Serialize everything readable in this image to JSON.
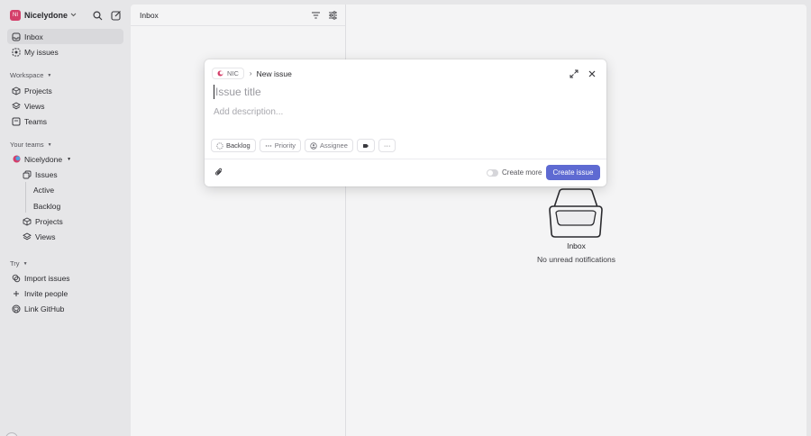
{
  "workspace": {
    "badge": "NI",
    "name": "Nicelydone",
    "accent": "#d43f6a"
  },
  "sidebar": {
    "top_items": [
      {
        "label": "Inbox",
        "icon": "inbox-icon",
        "active": true
      },
      {
        "label": "My issues",
        "icon": "target-icon",
        "active": false
      }
    ],
    "workspace_label": "Workspace",
    "workspace_items": [
      {
        "label": "Projects",
        "icon": "cube-icon"
      },
      {
        "label": "Views",
        "icon": "layers-icon"
      },
      {
        "label": "Teams",
        "icon": "square-icon"
      }
    ],
    "teams_label": "Your teams",
    "team": {
      "name": "Nicelydone"
    },
    "team_items": [
      {
        "label": "Issues",
        "icon": "stack-icon"
      },
      {
        "label": "Active"
      },
      {
        "label": "Backlog"
      },
      {
        "label": "Projects",
        "icon": "cube-icon"
      },
      {
        "label": "Views",
        "icon": "layers-icon"
      }
    ],
    "try_label": "Try",
    "try_items": [
      {
        "label": "Import issues",
        "icon": "import-icon"
      },
      {
        "label": "Invite people",
        "icon": "plus-icon"
      },
      {
        "label": "Link GitHub",
        "icon": "github-icon"
      }
    ]
  },
  "inbox_panel": {
    "title": "Inbox"
  },
  "empty_state": {
    "title": "Inbox",
    "subtitle": "No unread notifications"
  },
  "modal": {
    "team_key": "NIC",
    "separator": "›",
    "title": "New issue",
    "title_placeholder": "Issue title",
    "description_placeholder": "Add description...",
    "chips": {
      "status": "Backlog",
      "priority": "Priority",
      "assignee": "Assignee",
      "more": "···"
    },
    "create_more_label": "Create more",
    "create_more_on": false,
    "submit_label": "Create issue",
    "submit_color": "#5e6ad2"
  }
}
